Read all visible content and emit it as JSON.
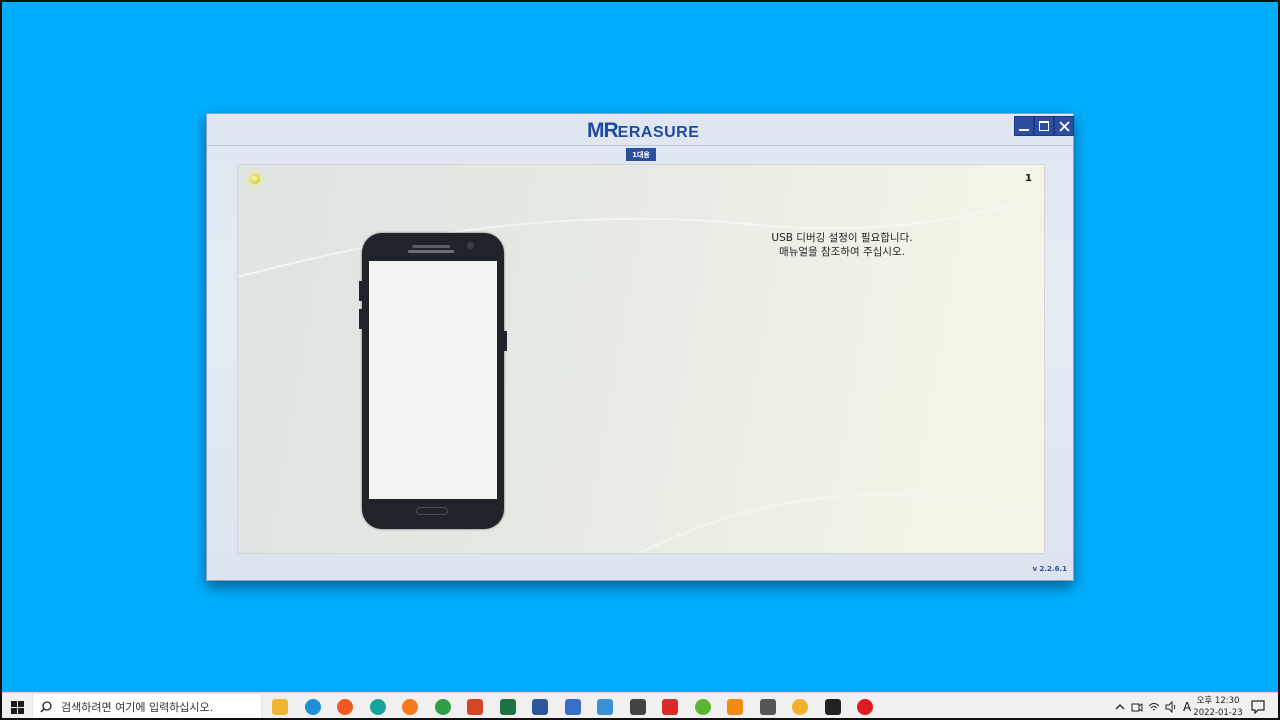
{
  "app": {
    "logo_mark": "MR",
    "logo_text": "ERASURE",
    "mode_badge": "1대용",
    "slot_number": "1",
    "message_line1": "USB 디버깅 설정이 필요합니다.",
    "message_line2": "매뉴얼을 참조하여 주십시오.",
    "version": "v 2.2.6.1",
    "accent_color": "#2c4ea0",
    "window_controls": [
      "minimize-icon",
      "maximize-icon",
      "close-icon"
    ]
  },
  "desktop": {
    "background_color": "#00aeff"
  },
  "taskbar": {
    "search_placeholder": "검색하려면 여기에 입력하십시오.",
    "pinned_apps": [
      {
        "name": "file-explorer-icon",
        "color": "#f2b632"
      },
      {
        "name": "edge-icon",
        "color": "#1f8fd6"
      },
      {
        "name": "brave-icon",
        "color": "#f05a22"
      },
      {
        "name": "edge-dev-icon",
        "color": "#1aa39a"
      },
      {
        "name": "firefox-icon",
        "color": "#f47a1f"
      },
      {
        "name": "chrome-icon",
        "color": "#2f9e44"
      },
      {
        "name": "powerpoint-icon",
        "color": "#d24726"
      },
      {
        "name": "excel-icon",
        "color": "#1f7244"
      },
      {
        "name": "word-icon",
        "color": "#2b579a"
      },
      {
        "name": "calendar-app-icon",
        "color": "#3a6fc7"
      },
      {
        "name": "remote-desktop-icon",
        "color": "#3a8fd6"
      },
      {
        "name": "search-tool-icon",
        "color": "#444444"
      },
      {
        "name": "se-app-icon",
        "color": "#d92b2b"
      },
      {
        "name": "green-app-icon",
        "color": "#5bb531"
      },
      {
        "name": "vlc-icon",
        "color": "#f28a11"
      },
      {
        "name": "calculator-icon",
        "color": "#555555"
      },
      {
        "name": "chrome-canary-icon",
        "color": "#f2b12f"
      },
      {
        "name": "sticky-app-icon",
        "color": "#222222"
      },
      {
        "name": "opera-icon",
        "color": "#e11a22"
      }
    ],
    "tray": {
      "ime": "A",
      "clock_line1": "오후 12:30",
      "clock_line2": "2022-01-23"
    }
  }
}
